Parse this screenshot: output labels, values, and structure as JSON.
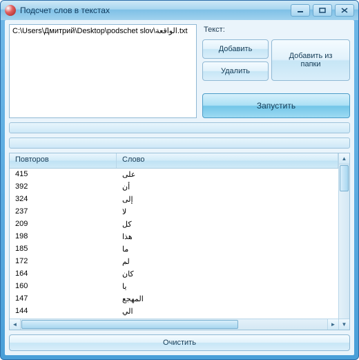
{
  "window": {
    "title": "Подсчет слов в текстах"
  },
  "file_list": {
    "items": [
      "C:\\Users\\Дмитрий\\Desktop\\podschet slov\\الواقعة.txt"
    ]
  },
  "panel": {
    "text_label": "Текст:",
    "add": "Добавить",
    "delete": "Удалить",
    "add_folder": "Добавить из папки",
    "run": "Запустить"
  },
  "table": {
    "headers": {
      "count": "Повторов",
      "word": "Слово"
    },
    "rows": [
      {
        "count": "415",
        "word": "على"
      },
      {
        "count": "392",
        "word": "أن"
      },
      {
        "count": "324",
        "word": "إلى"
      },
      {
        "count": "237",
        "word": "لا"
      },
      {
        "count": "209",
        "word": "كل"
      },
      {
        "count": "198",
        "word": "هذا"
      },
      {
        "count": "185",
        "word": "ما"
      },
      {
        "count": "172",
        "word": "لم"
      },
      {
        "count": "164",
        "word": "كان"
      },
      {
        "count": "160",
        "word": "يا"
      },
      {
        "count": "147",
        "word": "المهجع"
      },
      {
        "count": "144",
        "word": "الي"
      }
    ]
  },
  "footer": {
    "clear": "Очистить"
  }
}
